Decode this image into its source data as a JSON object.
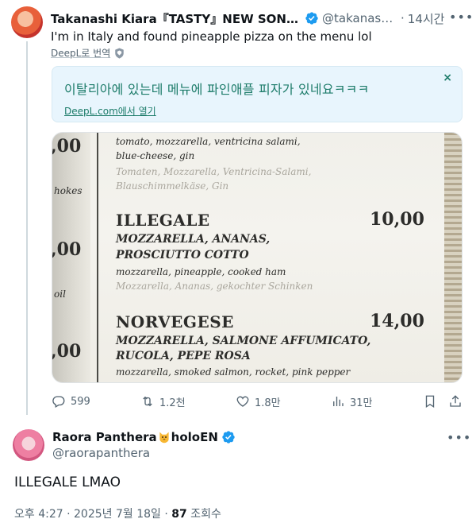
{
  "original_tweet": {
    "display_name": "Takanashi Kiara『TASTY』NEW SONG OU...",
    "handle": "@takanashi...",
    "separator": "·",
    "time": "14시간",
    "text": "I'm in Italy and found pineapple pizza on the menu lol",
    "translate_label": "DeepL로 번역",
    "translation": {
      "text": "이탈리아에 있는데 메뉴에 파인애플 피자가 있네요ㅋㅋㅋ",
      "link": "DeepL.com에서 열기",
      "close": "×"
    },
    "photo_menu": {
      "top_lines": [
        "tomato, mozzarella, ventricina salami,",
        "blue-cheese, gin"
      ],
      "top_german": [
        "Tomaten, Mozzarella, Ventricina-Salami,",
        "Blauschimmelkäse, Gin"
      ],
      "left_prices": [
        ",00",
        ",00",
        ",00"
      ],
      "left_words": [
        "hokes",
        "oil"
      ],
      "items": [
        {
          "name": "ILLEGALE",
          "price": "10,00",
          "italian": [
            "MOZZARELLA, ANANAS,",
            "PROSCIUTTO COTTO"
          ],
          "english": "mozzarella, pineapple, cooked ham",
          "german": "Mozzarella, Ananas, gekochter Schinken"
        },
        {
          "name": "NORVEGESE",
          "price": "14,00",
          "italian": [
            "MOZZARELLA, SALMONE AFFUMICATO,",
            "RUCOLA, PEPE ROSA"
          ],
          "english": "mozzarella, smoked salmon, rocket, pink pepper"
        }
      ]
    },
    "actions": {
      "replies": "599",
      "reposts": "1.2천",
      "likes": "1.8만",
      "views": "31만"
    }
  },
  "reply_tweet": {
    "display_name": "Raora Panthera",
    "display_name_suffix": "holoEN",
    "handle": "@raorapanthera",
    "text": "ILLEGALE LMAO",
    "time": "오후 4:27 · 2025년 7월 18일 · ",
    "views_count": "87",
    "views_label": " 조회수"
  },
  "colors": {
    "text": "#0f1419",
    "secondary": "#536471",
    "verified": "#1d9bf0",
    "translation_bg": "#e8f5fd",
    "translation_text": "#1d7c6a",
    "thread_line": "#cfd9de"
  },
  "icons": [
    "verified-badge-icon",
    "more-icon",
    "shield-icon",
    "reply-icon",
    "repost-icon",
    "like-icon",
    "views-icon",
    "bookmark-icon",
    "share-icon",
    "cat-emoji-icon"
  ]
}
